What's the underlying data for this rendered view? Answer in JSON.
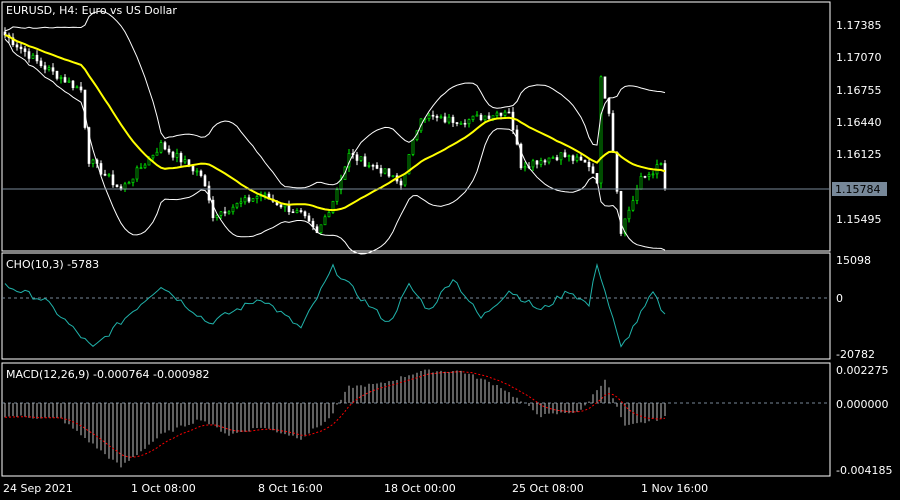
{
  "symbol_title": "EURUSD, H4:  Euro vs US Dollar",
  "current_price": "1.15784",
  "colors": {
    "bull": "#00ff00",
    "bear": "#ffffff",
    "ma": "#ffff00",
    "bands": "#ffffff",
    "cho": "#20b2aa",
    "signal": "#ff0000",
    "price_line": "#778899"
  },
  "chart_data": {
    "type": "line",
    "main": {
      "ylim": [
        1.1522,
        1.175
      ],
      "y_ticks": [
        "1.17385",
        "1.17070",
        "1.16755",
        "1.16440",
        "1.16125",
        "1.15495"
      ],
      "price_path": [
        [
          0,
          1.17288
        ],
        [
          9,
          1.16995
        ],
        [
          19,
          1.16752
        ],
        [
          21,
          1.1607
        ],
        [
          29,
          1.15778
        ],
        [
          39,
          1.16216
        ],
        [
          49,
          1.15924
        ],
        [
          52,
          1.15535
        ],
        [
          64,
          1.15729
        ],
        [
          74,
          1.15535
        ],
        [
          78,
          1.1534
        ],
        [
          82,
          1.1568
        ],
        [
          86,
          1.16119
        ],
        [
          94,
          1.15973
        ],
        [
          99,
          1.15827
        ],
        [
          104,
          1.16508
        ],
        [
          109,
          1.1646
        ],
        [
          116,
          1.1646
        ],
        [
          126,
          1.16557
        ],
        [
          129,
          1.16021
        ],
        [
          139,
          1.16119
        ],
        [
          146,
          1.16021
        ],
        [
          148,
          1.15878
        ],
        [
          149,
          1.16849
        ],
        [
          151,
          1.16557
        ],
        [
          154,
          1.15389
        ],
        [
          159,
          1.15876
        ],
        [
          164,
          1.16021
        ],
        [
          165,
          1.15784
        ]
      ]
    },
    "cho": {
      "label": "CHO(10,3) -5783",
      "y_ticks": [
        "15098",
        "0",
        "-20782"
      ],
      "ylim": [
        -20782,
        15098
      ],
      "path": [
        [
          0,
          5000
        ],
        [
          10,
          -1000
        ],
        [
          22,
          -20000
        ],
        [
          30,
          -8000
        ],
        [
          39,
          5000
        ],
        [
          51,
          -10000
        ],
        [
          64,
          0
        ],
        [
          74,
          -12000
        ],
        [
          82,
          12000
        ],
        [
          89,
          0
        ],
        [
          96,
          -10000
        ],
        [
          101,
          5000
        ],
        [
          106,
          -5000
        ],
        [
          112,
          8000
        ],
        [
          119,
          -8000
        ],
        [
          126,
          3000
        ],
        [
          134,
          -5000
        ],
        [
          141,
          3000
        ],
        [
          146,
          -3000
        ],
        [
          148,
          14000
        ],
        [
          154,
          -20000
        ],
        [
          162,
          2000
        ],
        [
          165,
          -7000
        ]
      ]
    },
    "macd": {
      "label": "MACD(12,26,9) -0.000764 -0.000982",
      "y_ticks": [
        "0.002275",
        "0.000000",
        "-0.004185"
      ],
      "ylim": [
        -0.004185,
        0.002275
      ],
      "hist_path": [
        [
          0,
          -0.0008
        ],
        [
          14,
          -0.001
        ],
        [
          29,
          -0.004
        ],
        [
          39,
          -0.002
        ],
        [
          49,
          -0.001
        ],
        [
          56,
          -0.002
        ],
        [
          64,
          -0.0015
        ],
        [
          74,
          -0.0022
        ],
        [
          81,
          -0.001
        ],
        [
          86,
          0.001
        ],
        [
          94,
          0.0012
        ],
        [
          104,
          0.002
        ],
        [
          114,
          0.002
        ],
        [
          124,
          0.001
        ],
        [
          134,
          -0.0008
        ],
        [
          144,
          -0.0005
        ],
        [
          150,
          0.0015
        ],
        [
          155,
          -0.0015
        ],
        [
          165,
          -0.0009
        ]
      ]
    },
    "time_labels": [
      "24 Sep 2021",
      "1 Oct 08:00",
      "8 Oct 16:00",
      "18 Oct 00:00",
      "25 Oct 08:00",
      "1 Nov 16:00"
    ]
  }
}
